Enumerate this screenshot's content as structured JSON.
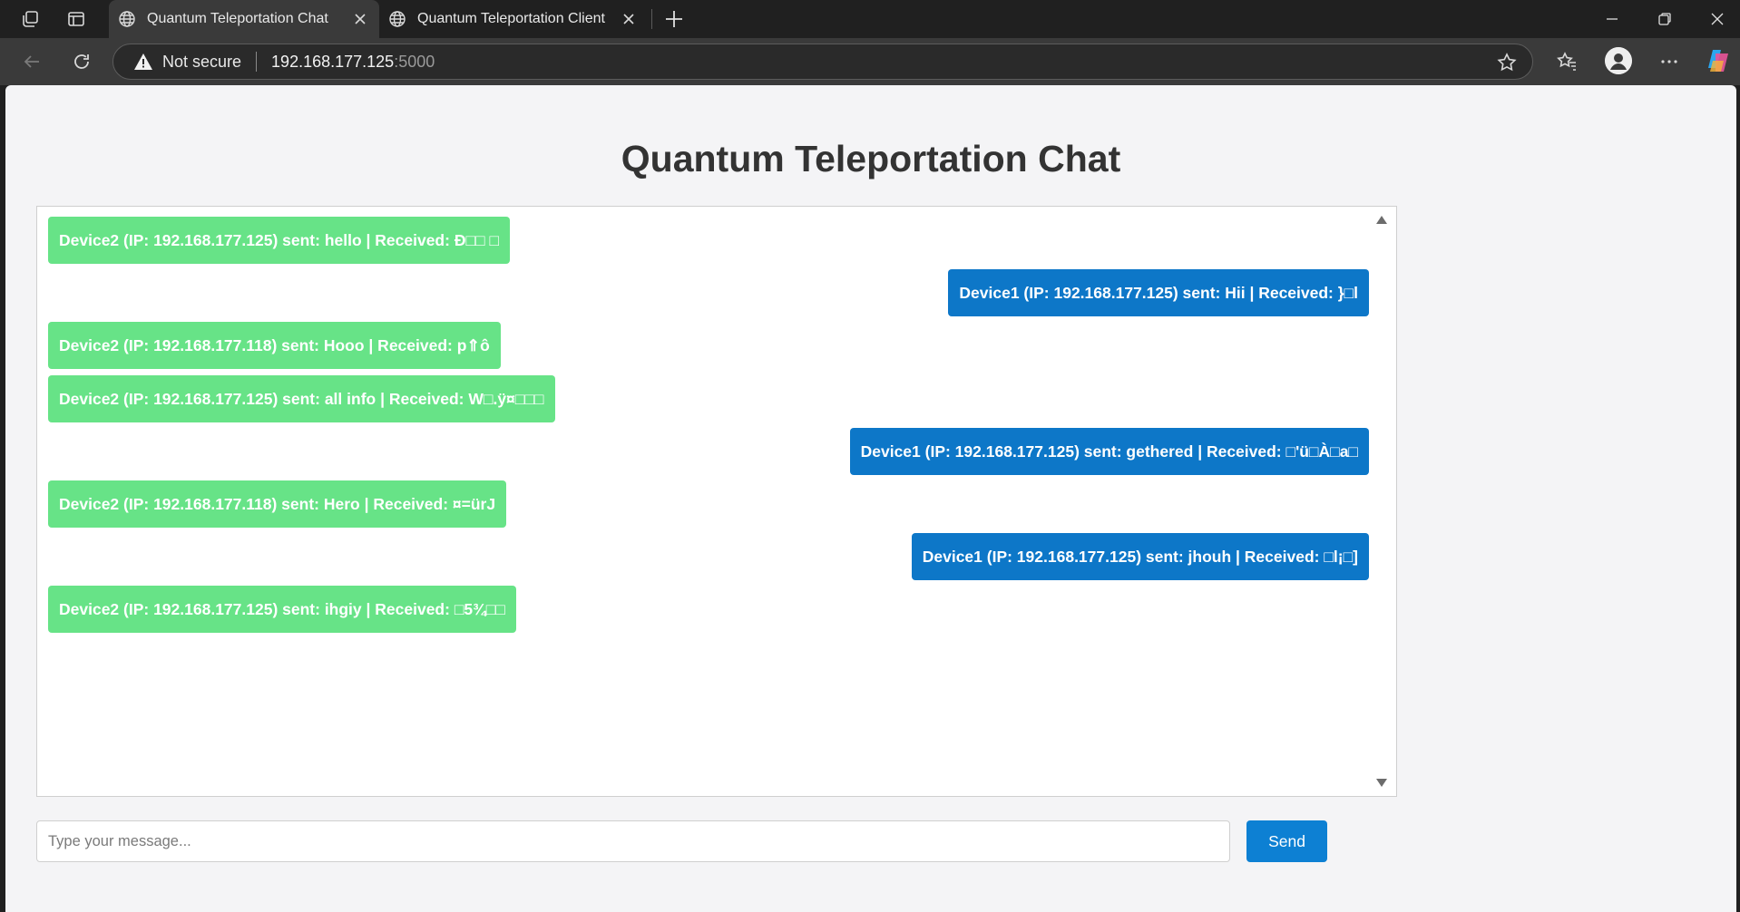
{
  "browser": {
    "tabs": [
      {
        "title": "Quantum Teleportation Chat",
        "active": true
      },
      {
        "title": "Quantum Teleportation Client",
        "active": false
      }
    ],
    "address": {
      "security_label": "Not secure",
      "host": "192.168.177.125",
      "port": ":5000"
    }
  },
  "page": {
    "title": "Quantum Teleportation Chat",
    "messages": [
      {
        "side": "left",
        "text": "Device2 (IP: 192.168.177.125) sent: hello | Received: Ð□□ □"
      },
      {
        "side": "right",
        "text": "Device1 (IP: 192.168.177.125) sent: Hii | Received: }□l"
      },
      {
        "side": "left",
        "text": "Device2 (IP: 192.168.177.118) sent: Hooo | Received: p⇑ô"
      },
      {
        "side": "left",
        "text": "Device2 (IP: 192.168.177.125) sent: all info | Received: W□.ÿ¤□□□"
      },
      {
        "side": "right",
        "text": "Device1 (IP: 192.168.177.125) sent: gethered | Received: □'ü□À□a□"
      },
      {
        "side": "left",
        "text": "Device2 (IP: 192.168.177.118) sent: Hero | Received: ¤=ürJ"
      },
      {
        "side": "right",
        "text": "Device1 (IP: 192.168.177.125) sent: jhouh | Received: □l¡□]"
      },
      {
        "side": "left",
        "text": "Device2 (IP: 192.168.177.125) sent: ihgiy | Received: □5¾□□"
      }
    ],
    "input": {
      "placeholder": "Type your message...",
      "value": ""
    },
    "send_label": "Send"
  },
  "colors": {
    "device2_bubble": "#67e387",
    "device1_bubble": "#0d77c8",
    "send_button": "#0d80d3"
  },
  "icons": [
    "workspaces-icon",
    "tab-actions-icon",
    "globe-icon",
    "close-icon",
    "new-tab-icon",
    "minimize-icon",
    "maximize-icon",
    "window-close-icon",
    "back-icon",
    "refresh-icon",
    "warning-icon",
    "star-icon",
    "favorites-icon",
    "profile-icon",
    "more-icon",
    "copilot-icon"
  ]
}
